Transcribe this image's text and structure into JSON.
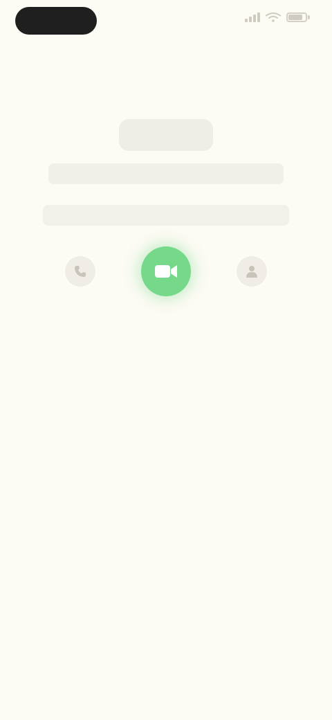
{
  "status_bar": {
    "time": "",
    "battery_level": 0.85,
    "colors": {
      "pill": "#1f1f1f",
      "icons": "#cfcbc0"
    }
  },
  "header": {
    "top_action_label": ""
  },
  "main": {
    "title": "",
    "subtitle": "",
    "info": ""
  },
  "actions": {
    "left": {
      "icon": "phone-icon",
      "label": ""
    },
    "center": {
      "icon": "video-icon",
      "label": "",
      "color": "#76d989"
    },
    "right": {
      "icon": "person-icon",
      "label": ""
    }
  },
  "theme": {
    "background": "#fcfbf4"
  }
}
